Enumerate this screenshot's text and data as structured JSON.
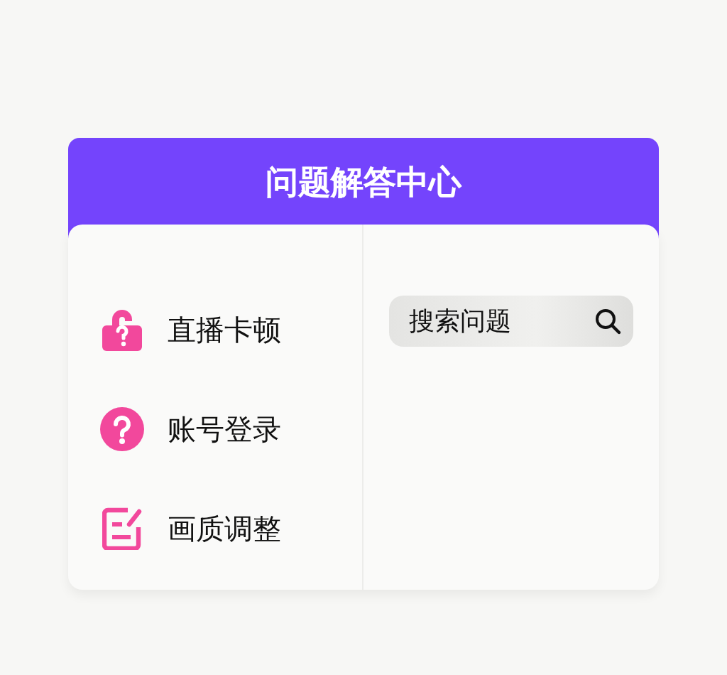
{
  "header": {
    "title": "问题解答中心"
  },
  "menu": [
    {
      "label": "直播卡顿",
      "kind": "lock"
    },
    {
      "label": "账号登录",
      "kind": "help"
    },
    {
      "label": "画质调整",
      "kind": "edit"
    }
  ],
  "search": {
    "placeholder": "搜索问题"
  }
}
